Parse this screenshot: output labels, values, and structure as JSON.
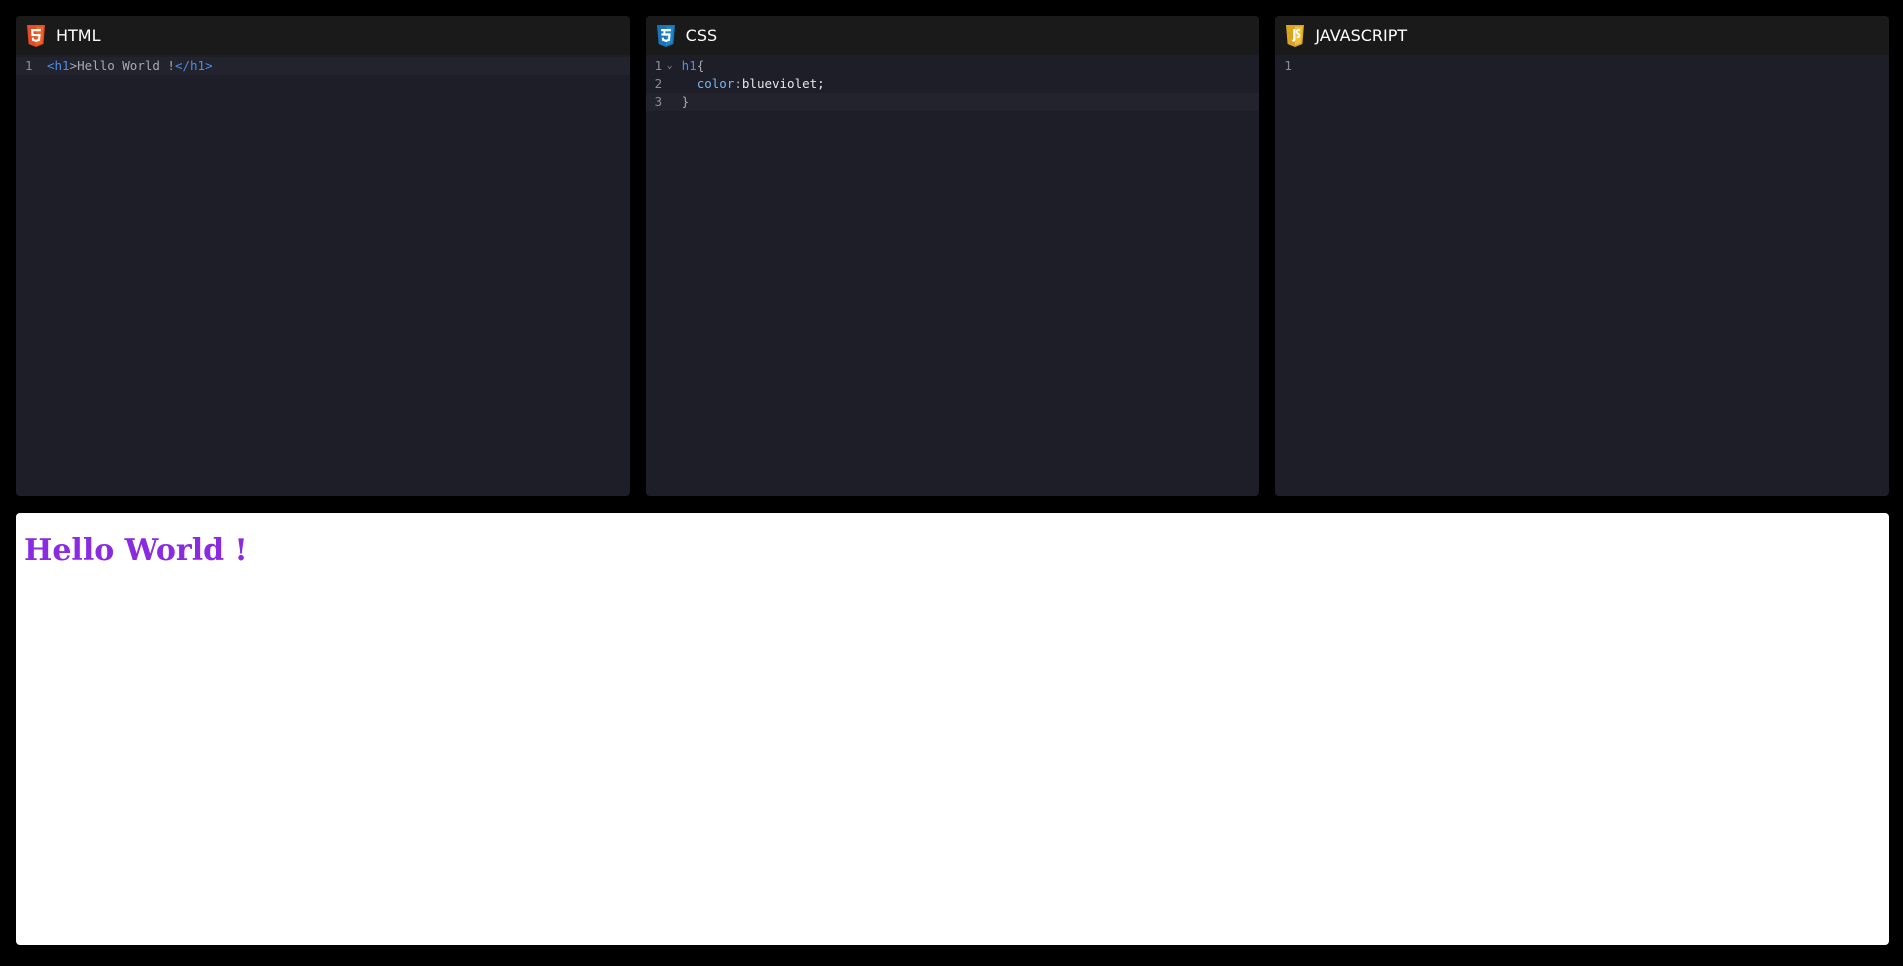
{
  "editors": {
    "html": {
      "title": "HTML",
      "icon": "html5-icon",
      "icon_color": "#e44d26",
      "lines": [
        {
          "num": "1",
          "t1": "<",
          "t2": "h1",
          "t3": ">Hello World !",
          "t4": "</",
          "t5": "h1",
          "t6": ">"
        }
      ]
    },
    "css": {
      "title": "CSS",
      "icon": "css3-icon",
      "icon_color": "#1b73ba",
      "lines": [
        {
          "num": "1",
          "sel": "h1",
          "open": "{"
        },
        {
          "num": "2",
          "indent": "  ",
          "prop": "color",
          "colon": ":",
          "val": "blueviolet",
          "semi": ";"
        },
        {
          "num": "3",
          "close": "}"
        }
      ]
    },
    "js": {
      "title": "JAVASCRIPT",
      "icon": "javascript-icon",
      "icon_color": "#e4b030",
      "lines": [
        {
          "num": "1"
        }
      ]
    }
  },
  "preview": {
    "heading": "Hello World !",
    "heading_color": "#8a2be2"
  }
}
